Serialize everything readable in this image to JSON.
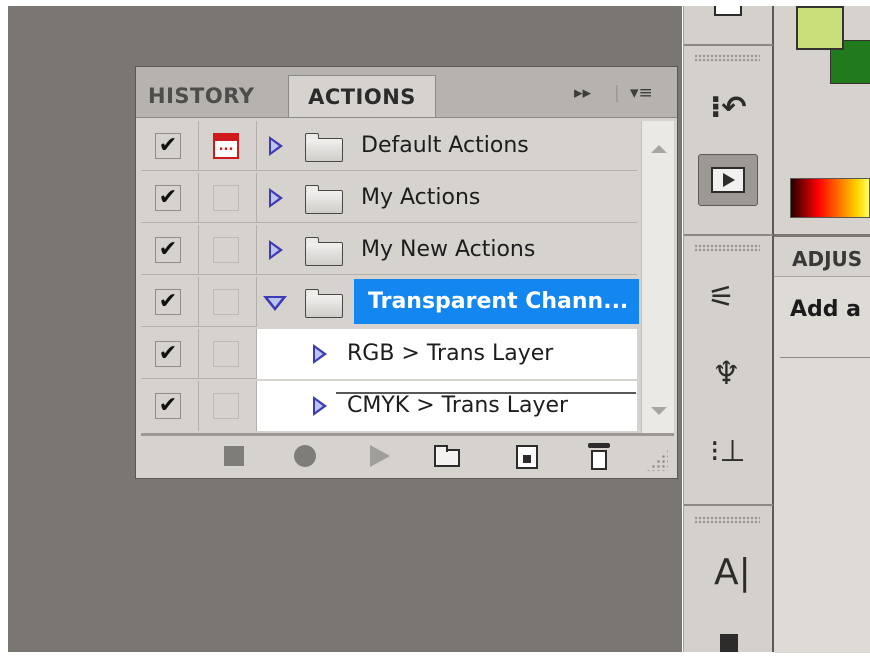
{
  "tabs": {
    "history": "HISTORY",
    "actions": "ACTIONS"
  },
  "tab_controls": {
    "expand": "▸▸",
    "menu": "▾≡"
  },
  "action_rows": [
    {
      "check": "✔",
      "name": "Default Actions"
    },
    {
      "check": "✔",
      "name": "My Actions"
    },
    {
      "check": "✔",
      "name": "My New Actions"
    },
    {
      "check": "✔",
      "name": "Transparent Chann..."
    },
    {
      "check": "✔",
      "name": "RGB > Trans Layer"
    },
    {
      "check": "✔",
      "name": "CMYK > Trans Layer"
    }
  ],
  "dialog_toggle_glyph": "...",
  "dock": {
    "type_glyph": "A|"
  },
  "adjustments": {
    "tab": "ADJUS",
    "text": "Add a"
  },
  "colors": {
    "selection": "#1486f0",
    "foreground_swatch": "#c9e07a",
    "background_swatch": "#217a1c",
    "triangle": "#3c3cb4"
  }
}
